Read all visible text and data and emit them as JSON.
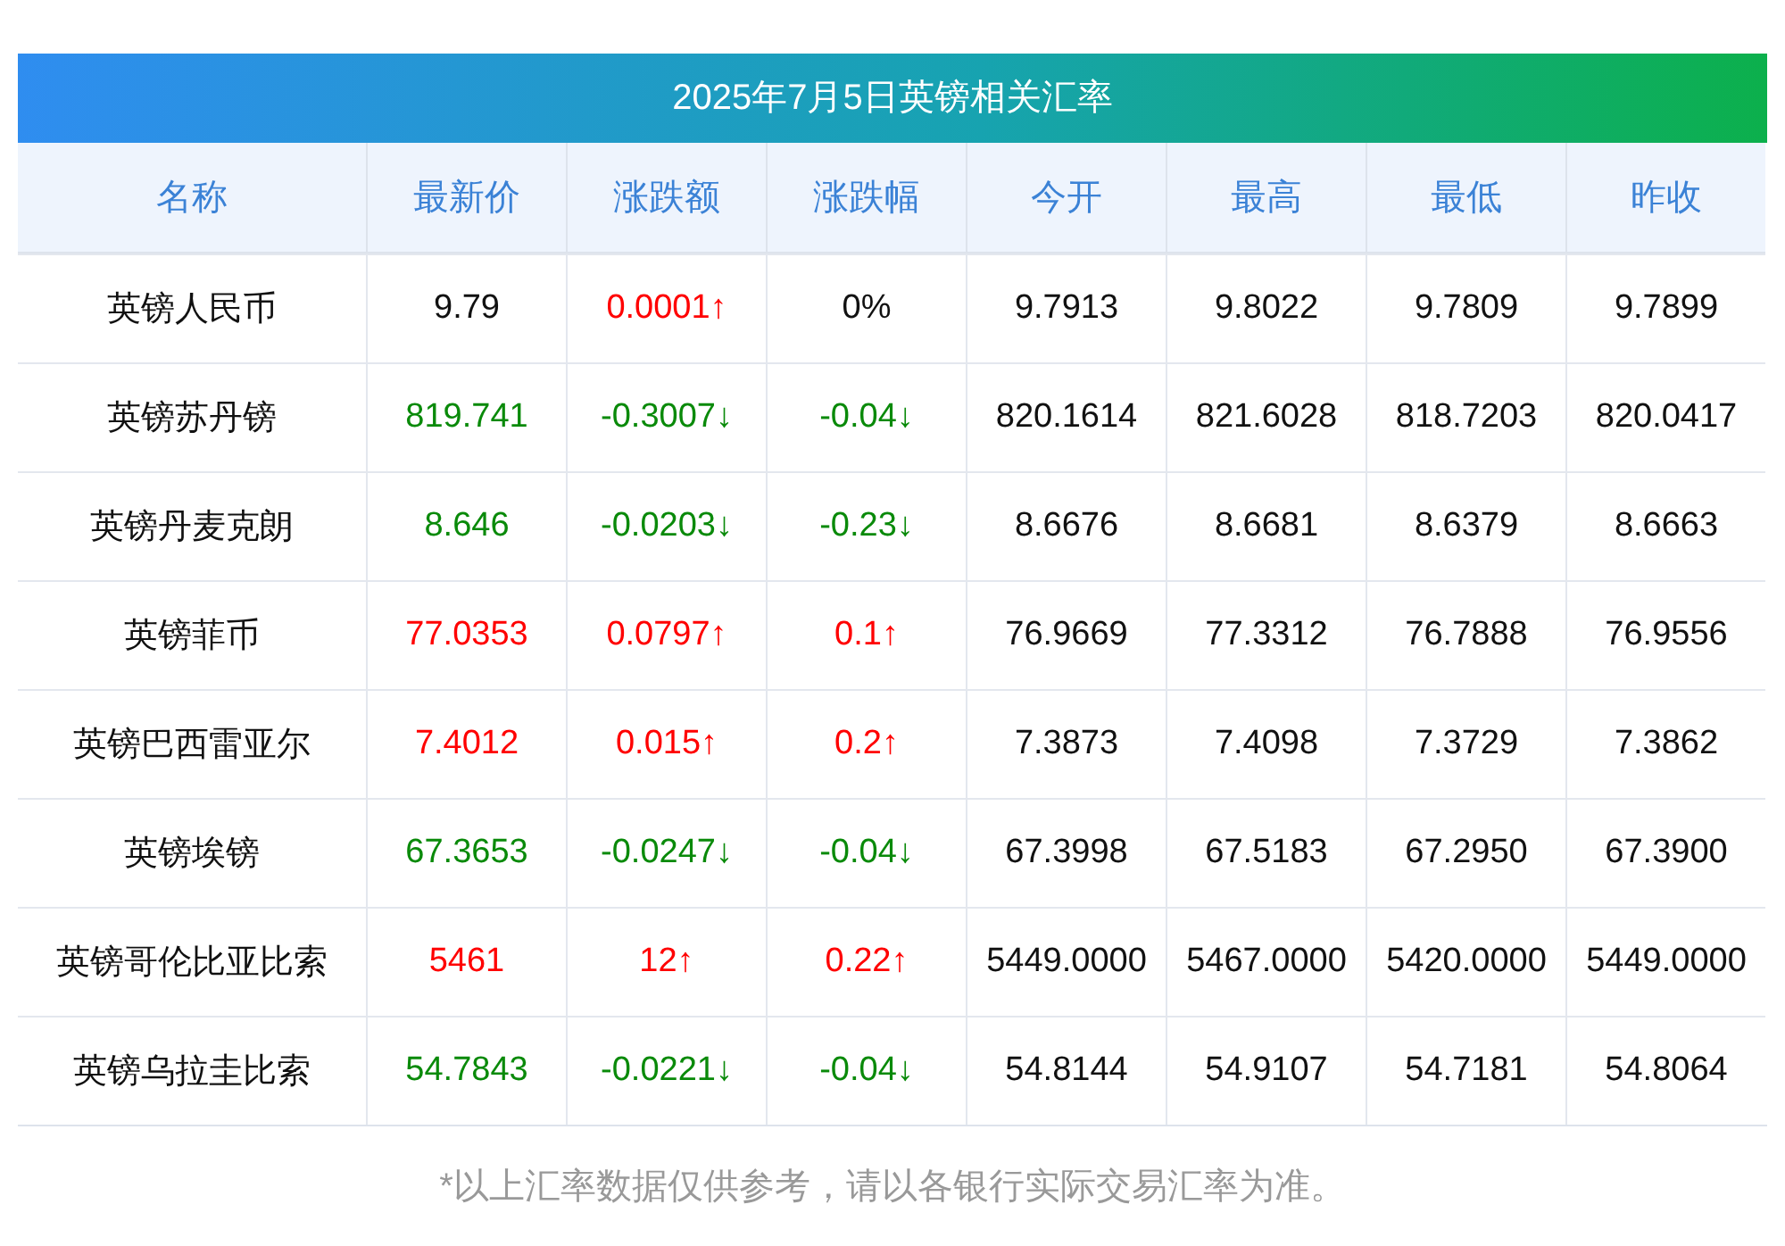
{
  "title": "2025年7月5日英镑相关汇率",
  "columns": [
    "名称",
    "最新价",
    "涨跌额",
    "涨跌幅",
    "今开",
    "最高",
    "最低",
    "昨收"
  ],
  "rows": [
    {
      "name": "英镑人民币",
      "price": {
        "text": "9.79",
        "color": "#111111"
      },
      "change": {
        "text": "0.0001↑",
        "color": "#ff0000"
      },
      "pct": {
        "text": "0%",
        "color": "#111111"
      },
      "open": "9.7913",
      "high": "9.8022",
      "low": "9.7809",
      "prev": "9.7899"
    },
    {
      "name": "英镑苏丹镑",
      "price": {
        "text": "819.741",
        "color": "#0a8a0a"
      },
      "change": {
        "text": "-0.3007↓",
        "color": "#0a8a0a"
      },
      "pct": {
        "text": "-0.04↓",
        "color": "#0a8a0a"
      },
      "open": "820.1614",
      "high": "821.6028",
      "low": "818.7203",
      "prev": "820.0417"
    },
    {
      "name": "英镑丹麦克朗",
      "price": {
        "text": "8.646",
        "color": "#0a8a0a"
      },
      "change": {
        "text": "-0.0203↓",
        "color": "#0a8a0a"
      },
      "pct": {
        "text": "-0.23↓",
        "color": "#0a8a0a"
      },
      "open": "8.6676",
      "high": "8.6681",
      "low": "8.6379",
      "prev": "8.6663"
    },
    {
      "name": "英镑菲币",
      "price": {
        "text": "77.0353",
        "color": "#ff0000"
      },
      "change": {
        "text": "0.0797↑",
        "color": "#ff0000"
      },
      "pct": {
        "text": "0.1↑",
        "color": "#ff0000"
      },
      "open": "76.9669",
      "high": "77.3312",
      "low": "76.7888",
      "prev": "76.9556"
    },
    {
      "name": "英镑巴西雷亚尔",
      "price": {
        "text": "7.4012",
        "color": "#ff0000"
      },
      "change": {
        "text": "0.015↑",
        "color": "#ff0000"
      },
      "pct": {
        "text": "0.2↑",
        "color": "#ff0000"
      },
      "open": "7.3873",
      "high": "7.4098",
      "low": "7.3729",
      "prev": "7.3862"
    },
    {
      "name": "英镑埃镑",
      "price": {
        "text": "67.3653",
        "color": "#0a8a0a"
      },
      "change": {
        "text": "-0.0247↓",
        "color": "#0a8a0a"
      },
      "pct": {
        "text": "-0.04↓",
        "color": "#0a8a0a"
      },
      "open": "67.3998",
      "high": "67.5183",
      "low": "67.2950",
      "prev": "67.3900"
    },
    {
      "name": "英镑哥伦比亚比索",
      "price": {
        "text": "5461",
        "color": "#ff0000"
      },
      "change": {
        "text": "12↑",
        "color": "#ff0000"
      },
      "pct": {
        "text": "0.22↑",
        "color": "#ff0000"
      },
      "open": "5449.0000",
      "high": "5467.0000",
      "low": "5420.0000",
      "prev": "5449.0000"
    },
    {
      "name": "英镑乌拉圭比索",
      "price": {
        "text": "54.7843",
        "color": "#0a8a0a"
      },
      "change": {
        "text": "-0.0221↓",
        "color": "#0a8a0a"
      },
      "pct": {
        "text": "-0.04↓",
        "color": "#0a8a0a"
      },
      "open": "54.8144",
      "high": "54.9107",
      "low": "54.7181",
      "prev": "54.8064"
    }
  ],
  "footnote": "*以上汇率数据仅供参考，请以各银行实际交易汇率为准。"
}
